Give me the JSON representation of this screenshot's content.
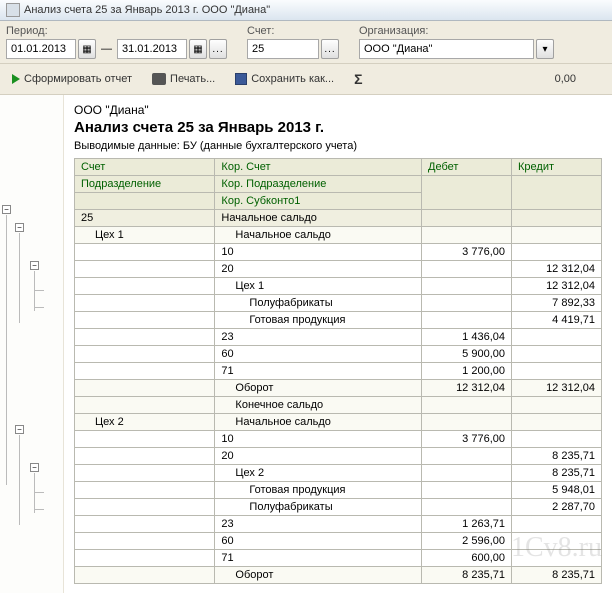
{
  "window": {
    "title": "Анализ счета 25 за Январь 2013 г. ООО \"Диана\""
  },
  "filters": {
    "period_label": "Период:",
    "date_from": "01.01.2013",
    "date_to": "31.01.2013",
    "date_sep": "—",
    "account_label": "Счет:",
    "account_value": "25",
    "org_label": "Организация:",
    "org_value": "ООО \"Диана\"",
    "ellipsis": "..."
  },
  "toolbar": {
    "generate": "Сформировать отчет",
    "print": "Печать...",
    "save_as": "Сохранить как...",
    "sigma": "Σ",
    "sum": "0,00"
  },
  "report": {
    "company": "ООО \"Диана\"",
    "title": "Анализ счета 25 за Январь 2013 г.",
    "subtitle_label": "Выводимые данные:",
    "subtitle_value": "БУ (данные бухгалтерского учета)",
    "headers": {
      "account": "Счет",
      "cor_account": "Кор. Счет",
      "debit": "Дебет",
      "credit": "Кредит",
      "division": "Подразделение",
      "cor_division": "Кор. Подразделение",
      "cor_sub": "Кор. Субконто1"
    },
    "rows": [
      {
        "cls": "alt",
        "c1": "25",
        "c2": "Начальное сальдо",
        "d": "",
        "k": ""
      },
      {
        "cls": "light",
        "c1": "Цех 1",
        "c1i": 1,
        "c2": "Начальное сальдо",
        "c2i": 1,
        "d": "",
        "k": ""
      },
      {
        "cls": "",
        "c1": "",
        "c2": "10",
        "d": "3 776,00",
        "k": ""
      },
      {
        "cls": "",
        "c1": "",
        "c2": "20",
        "d": "",
        "k": "12 312,04"
      },
      {
        "cls": "",
        "c1": "",
        "c2": "Цех 1",
        "c2i": 1,
        "d": "",
        "k": "12 312,04"
      },
      {
        "cls": "",
        "c1": "",
        "c2": "Полуфабрикаты",
        "c2i": 2,
        "d": "",
        "k": "7 892,33"
      },
      {
        "cls": "",
        "c1": "",
        "c2": "Готовая продукция",
        "c2i": 2,
        "d": "",
        "k": "4 419,71"
      },
      {
        "cls": "",
        "c1": "",
        "c2": "23",
        "d": "1 436,04",
        "k": ""
      },
      {
        "cls": "",
        "c1": "",
        "c2": "60",
        "d": "5 900,00",
        "k": ""
      },
      {
        "cls": "",
        "c1": "",
        "c2": "71",
        "d": "1 200,00",
        "k": ""
      },
      {
        "cls": "light",
        "c1": "",
        "c2": "Оборот",
        "c2i": 1,
        "d": "12 312,04",
        "k": "12 312,04"
      },
      {
        "cls": "light",
        "c1": "",
        "c2": "Конечное сальдо",
        "c2i": 1,
        "d": "",
        "k": ""
      },
      {
        "cls": "light",
        "c1": "Цех 2",
        "c1i": 1,
        "c2": "Начальное сальдо",
        "c2i": 1,
        "d": "",
        "k": ""
      },
      {
        "cls": "",
        "c1": "",
        "c2": "10",
        "d": "3 776,00",
        "k": ""
      },
      {
        "cls": "",
        "c1": "",
        "c2": "20",
        "d": "",
        "k": "8 235,71"
      },
      {
        "cls": "",
        "c1": "",
        "c2": "Цех 2",
        "c2i": 1,
        "d": "",
        "k": "8 235,71"
      },
      {
        "cls": "",
        "c1": "",
        "c2": "Готовая продукция",
        "c2i": 2,
        "d": "",
        "k": "5 948,01"
      },
      {
        "cls": "",
        "c1": "",
        "c2": "Полуфабрикаты",
        "c2i": 2,
        "d": "",
        "k": "2 287,70"
      },
      {
        "cls": "",
        "c1": "",
        "c2": "23",
        "d": "1 263,71",
        "k": ""
      },
      {
        "cls": "",
        "c1": "",
        "c2": "60",
        "d": "2 596,00",
        "k": ""
      },
      {
        "cls": "",
        "c1": "",
        "c2": "71",
        "d": "600,00",
        "k": ""
      },
      {
        "cls": "light",
        "c1": "",
        "c2": "Оборот",
        "c2i": 1,
        "d": "8 235,71",
        "k": "8 235,71"
      }
    ]
  },
  "watermark": "1Cv8.ru"
}
